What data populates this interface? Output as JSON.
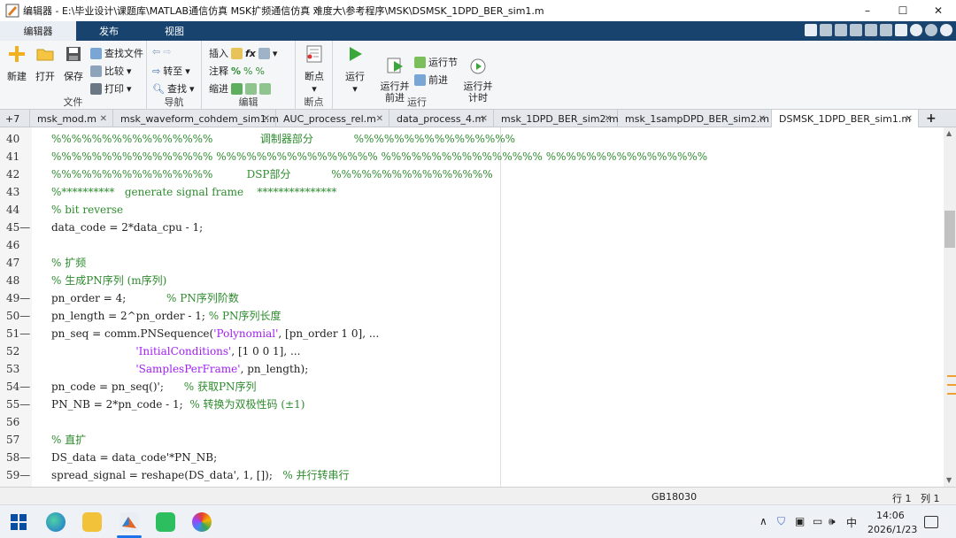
{
  "window": {
    "title": "编辑器 - E:\\毕业设计\\课题库\\MATLAB通信仿真 MSK扩频通信仿真 难度大\\参考程序\\MSK\\DSMSK_1DPD_BER_sim1.m",
    "minimize": "–",
    "maximize": "☐",
    "close": "✕"
  },
  "ribbon_tabs": [
    "编辑器",
    "发布",
    "视图"
  ],
  "ribbon": {
    "file_group": {
      "label": "文件",
      "new": "新建",
      "open": "打开",
      "save": "保存",
      "find_files": "查找文件",
      "compare": "比较",
      "print": "打印"
    },
    "nav_group": {
      "label": "导航",
      "goto": "转至",
      "find": "查找"
    },
    "edit_group": {
      "label": "编辑",
      "insert": "插入",
      "comment": "注释",
      "indent": "缩进",
      "fx": "fx"
    },
    "breakpoint_group": {
      "label": "断点",
      "breakpoints": "断点"
    },
    "run_group": {
      "label": "运行",
      "run": "运行",
      "run_advance": "运行并\n前进",
      "run_section": "运行节",
      "advance": "前进",
      "run_time": "运行并\n计时"
    }
  },
  "doc_tabs": {
    "overflow": "+7",
    "tabs": [
      "msk_mod.m",
      "msk_waveform_cohdem_sim1.m",
      "AUC_process_rel.m",
      "data_process_4.m",
      "msk_1DPD_BER_sim2.m",
      "msk_1sampDPD_BER_sim2.m",
      "DSMSK_1DPD_BER_sim1.m"
    ],
    "active_index": 6,
    "add": "+"
  },
  "code_lines": [
    {
      "n": "40",
      "parts": [
        {
          "t": "%%%%%%%%%%%%%%%%              调制器部分            %%%%%%%%%%%%%%%%",
          "c": "cm"
        }
      ]
    },
    {
      "n": "41",
      "parts": [
        {
          "t": "%%%%%%%%%%%%%%%% %%%%%%%%%%%%%%%% %%%%%%%%%%%%%%%% %%%%%%%%%%%%%%%%",
          "c": "cm"
        }
      ]
    },
    {
      "n": "42",
      "parts": [
        {
          "t": "%%%%%%%%%%%%%%%%          DSP部分            %%%%%%%%%%%%%%%%",
          "c": "cm"
        }
      ]
    },
    {
      "n": "43",
      "parts": [
        {
          "t": "%**********   generate signal frame    ***************",
          "c": "cm"
        }
      ]
    },
    {
      "n": "44",
      "parts": [
        {
          "t": "% bit reverse",
          "c": "cm"
        }
      ]
    },
    {
      "n": "45—",
      "parts": [
        {
          "t": "data_code = 2*data_cpu - 1;",
          "c": ""
        }
      ]
    },
    {
      "n": "46",
      "parts": []
    },
    {
      "n": "47",
      "parts": [
        {
          "t": "% 扩频",
          "c": "cm"
        }
      ]
    },
    {
      "n": "48",
      "parts": [
        {
          "t": "% 生成PN序列 (m序列)",
          "c": "cm"
        }
      ]
    },
    {
      "n": "49—",
      "parts": [
        {
          "t": "pn_order = 4;            ",
          "c": ""
        },
        {
          "t": "% PN序列阶数",
          "c": "cm"
        }
      ]
    },
    {
      "n": "50—",
      "parts": [
        {
          "t": "pn_length = 2^pn_order - 1; ",
          "c": ""
        },
        {
          "t": "% PN序列长度",
          "c": "cm"
        }
      ]
    },
    {
      "n": "51—",
      "parts": [
        {
          "t": "pn_seq = comm.PNSequence(",
          "c": ""
        },
        {
          "t": "'Polynomial'",
          "c": "st"
        },
        {
          "t": ", [pn_order 1 0], ...",
          "c": ""
        }
      ]
    },
    {
      "n": "52",
      "parts": [
        {
          "t": "                         ",
          "c": ""
        },
        {
          "t": "'InitialConditions'",
          "c": "st"
        },
        {
          "t": ", [1 0 0 1], ...",
          "c": ""
        }
      ]
    },
    {
      "n": "53",
      "parts": [
        {
          "t": "                         ",
          "c": ""
        },
        {
          "t": "'SamplesPerFrame'",
          "c": "st"
        },
        {
          "t": ", pn_length);",
          "c": ""
        }
      ]
    },
    {
      "n": "54—",
      "parts": [
        {
          "t": "pn_code = pn_seq()';      ",
          "c": ""
        },
        {
          "t": "% 获取PN序列",
          "c": "cm"
        }
      ]
    },
    {
      "n": "55—",
      "parts": [
        {
          "t": "PN_NB = 2*pn_code - 1;  ",
          "c": ""
        },
        {
          "t": "% 转换为双极性码 (±1)",
          "c": "cm"
        }
      ]
    },
    {
      "n": "56",
      "parts": []
    },
    {
      "n": "57",
      "parts": [
        {
          "t": "% 直扩",
          "c": "cm"
        }
      ]
    },
    {
      "n": "58—",
      "parts": [
        {
          "t": "DS_data = data_code'*PN_NB;",
          "c": ""
        }
      ]
    },
    {
      "n": "59—",
      "parts": [
        {
          "t": "spread_signal = reshape(DS_data', 1, []);   ",
          "c": ""
        },
        {
          "t": "% 并行转串行",
          "c": "cm"
        }
      ]
    }
  ],
  "status": {
    "encoding": "GB18030",
    "row": "行 1",
    "col": "列 1"
  },
  "taskbar": {
    "time": "14:06",
    "date": "2026/1/23",
    "ime": "中",
    "chevron": "∧"
  }
}
